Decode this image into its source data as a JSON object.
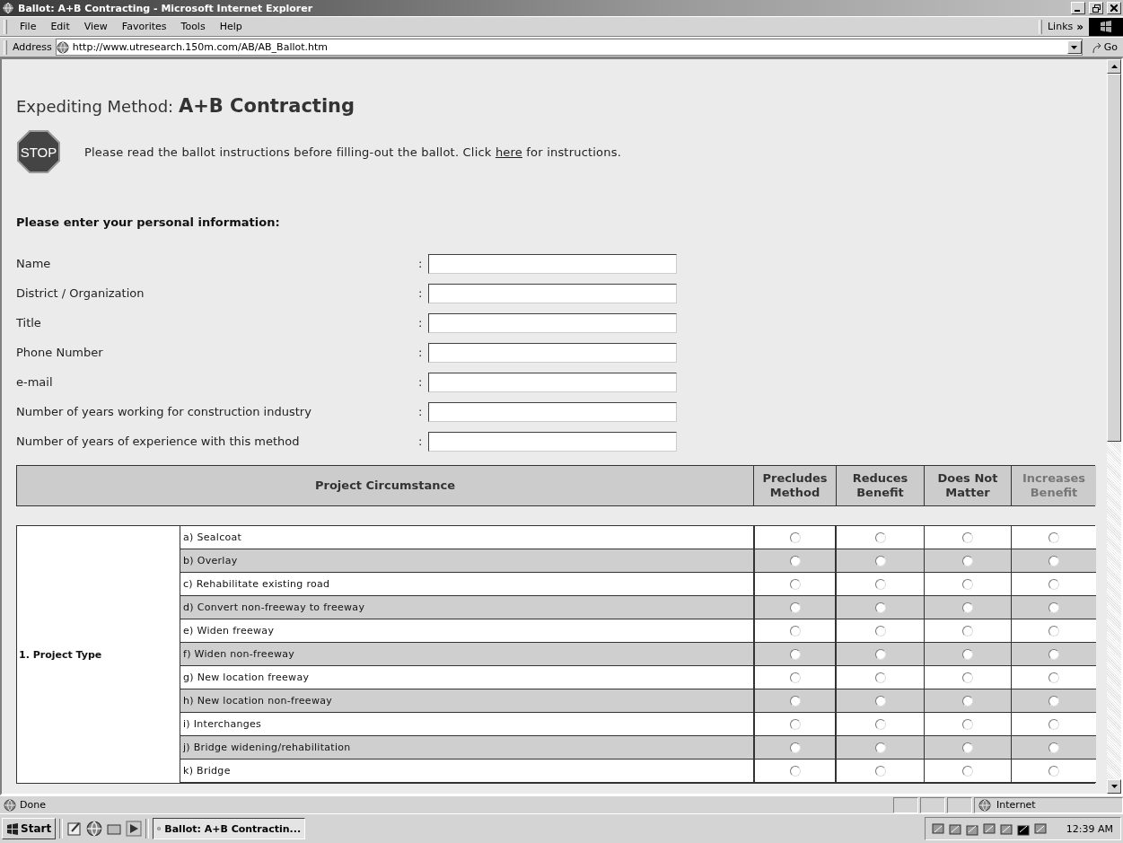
{
  "window": {
    "title": "Ballot: A+B Contracting - Microsoft Internet Explorer"
  },
  "menu": [
    "File",
    "Edit",
    "View",
    "Favorites",
    "Tools",
    "Help"
  ],
  "links": {
    "label": "Links",
    "chevron": "»"
  },
  "address": {
    "label": "Address",
    "url": "http://www.utresearch.150m.com/AB/AB_Ballot.htm",
    "go": "Go"
  },
  "page": {
    "heading_prefix": "Expediting Method:",
    "heading_method": "A+B Contracting",
    "stop_sign": "STOP",
    "notice_before": "Please read the ballot instructions before filling-out the ballot. Click",
    "notice_link": "here",
    "notice_after": "for instructions.",
    "personal_heading": "Please enter your personal information:",
    "fields": [
      {
        "label": "Name",
        "separator": ":"
      },
      {
        "label": "District / Organization",
        "separator": ":"
      },
      {
        "label": "Title",
        "separator": ":"
      },
      {
        "label": "Phone Number",
        "separator": ":"
      },
      {
        "label": "e-mail",
        "separator": ":"
      },
      {
        "label": "Number of years working for construction industry",
        "separator": ":"
      },
      {
        "label": "Number of years of experience with this method",
        "separator": ":"
      }
    ],
    "table": {
      "columns": [
        {
          "label": "Project Circumstance",
          "dimmed": false
        },
        {
          "label": "Precludes Method",
          "dimmed": false
        },
        {
          "label": "Reduces Benefit",
          "dimmed": false
        },
        {
          "label": "Does Not Matter",
          "dimmed": false
        },
        {
          "label": "Increases Benefit",
          "dimmed": true
        }
      ],
      "groups": [
        {
          "label": "1. Project Type",
          "rows": [
            {
              "label": "a) Sealcoat",
              "options": [
                {
                  "selected": false
                },
                {
                  "selected": false
                },
                {
                  "selected": false
                },
                {
                  "selected": false
                }
              ]
            },
            {
              "label": "b) Overlay",
              "options": [
                {
                  "selected": false
                },
                {
                  "selected": false
                },
                {
                  "selected": false
                },
                {
                  "selected": false
                }
              ]
            },
            {
              "label": "c) Rehabilitate existing road",
              "options": [
                {
                  "selected": false
                },
                {
                  "selected": false
                },
                {
                  "selected": false
                },
                {
                  "selected": false
                }
              ]
            },
            {
              "label": "d) Convert non-freeway to freeway",
              "options": [
                {
                  "selected": false
                },
                {
                  "selected": false
                },
                {
                  "selected": false
                },
                {
                  "selected": false
                }
              ]
            },
            {
              "label": "e) Widen freeway",
              "options": [
                {
                  "selected": false
                },
                {
                  "selected": false
                },
                {
                  "selected": false
                },
                {
                  "selected": false
                }
              ]
            },
            {
              "label": "f) Widen non-freeway",
              "options": [
                {
                  "selected": false
                },
                {
                  "selected": false
                },
                {
                  "selected": false
                },
                {
                  "selected": false
                }
              ]
            },
            {
              "label": "g) New location freeway",
              "options": [
                {
                  "selected": false
                },
                {
                  "selected": false
                },
                {
                  "selected": false
                },
                {
                  "selected": false
                }
              ]
            },
            {
              "label": "h) New location non-freeway",
              "options": [
                {
                  "selected": false
                },
                {
                  "selected": false
                },
                {
                  "selected": false
                },
                {
                  "selected": false
                }
              ]
            },
            {
              "label": "i) Interchanges",
              "options": [
                {
                  "selected": false
                },
                {
                  "selected": false
                },
                {
                  "selected": false
                },
                {
                  "selected": false
                }
              ]
            },
            {
              "label": "j) Bridge widening/rehabilitation",
              "options": [
                {
                  "selected": false
                },
                {
                  "selected": false
                },
                {
                  "selected": false
                },
                {
                  "selected": false
                }
              ]
            },
            {
              "label": "k) Bridge",
              "options": [
                {
                  "selected": false
                },
                {
                  "selected": false
                },
                {
                  "selected": false
                },
                {
                  "selected": false
                }
              ]
            }
          ]
        }
      ]
    }
  },
  "status_bar": {
    "text": "Done",
    "zone": "Internet"
  },
  "taskbar": {
    "start": "Start",
    "task": "Ballot: A+B Contractin...",
    "clock": "12:39 AM"
  }
}
